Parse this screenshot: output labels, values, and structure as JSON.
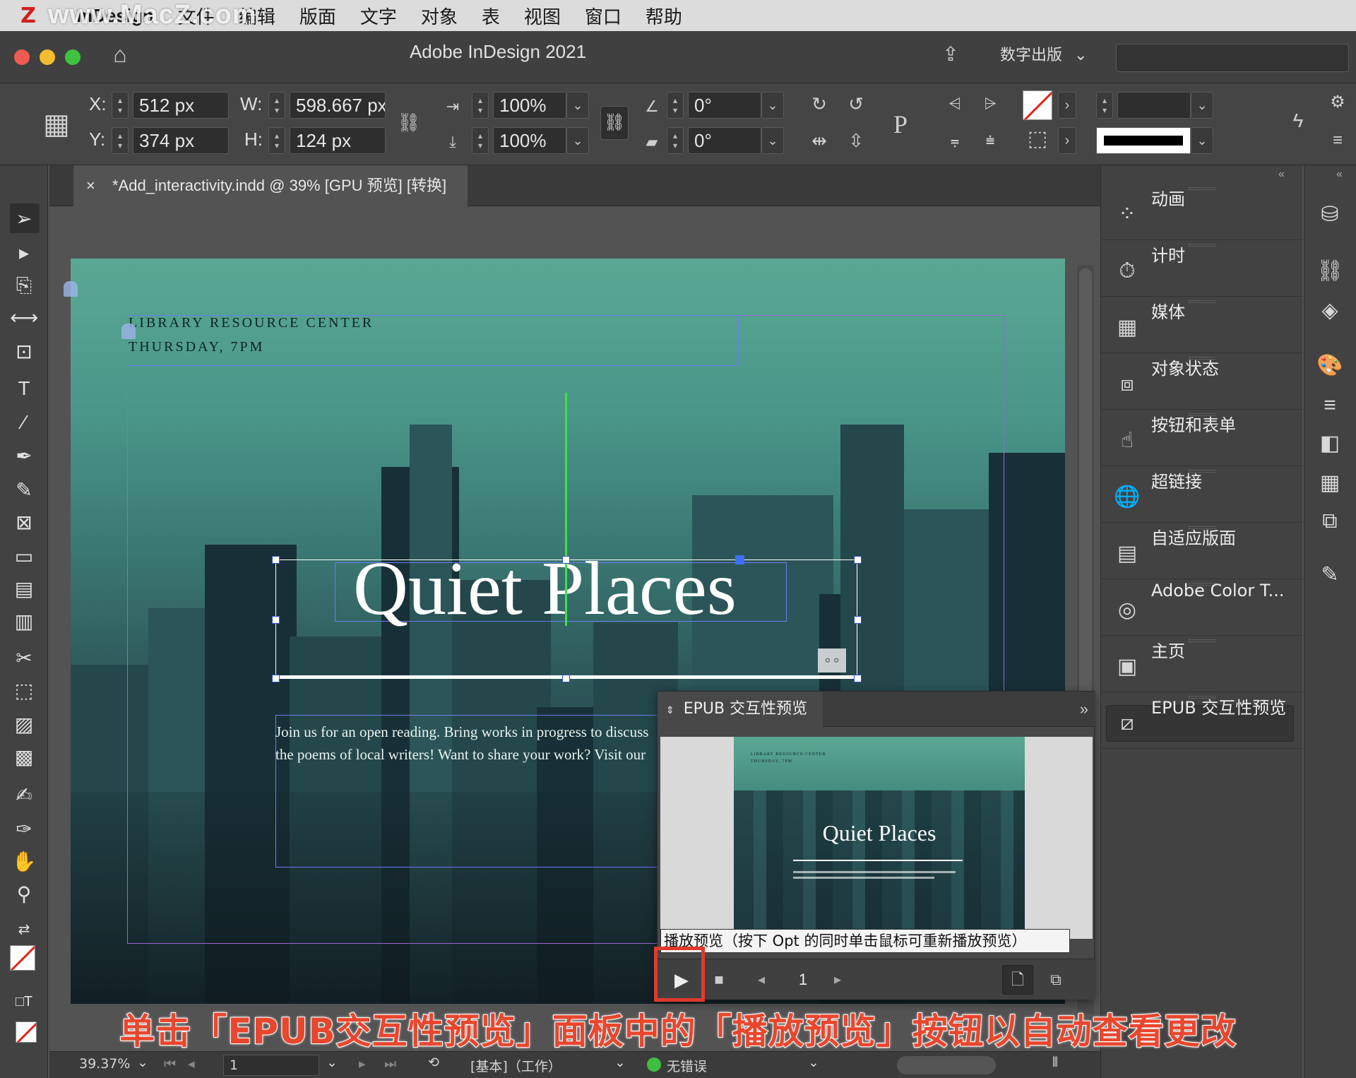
{
  "menubar": {
    "watermark": "www.MacZ.com",
    "app_name": "InDesign",
    "items": [
      "文件",
      "编辑",
      "版面",
      "文字",
      "对象",
      "表",
      "视图",
      "窗口",
      "帮助"
    ]
  },
  "titlebar": {
    "title": "Adobe InDesign 2021",
    "workspace": "数字出版"
  },
  "control": {
    "x_label": "X:",
    "x_value": "512 px",
    "y_label": "Y:",
    "y_value": "374 px",
    "w_label": "W:",
    "w_value": "598.667 px",
    "h_label": "H:",
    "h_value": "124 px",
    "scale_x": "100%",
    "scale_y": "100%",
    "rotate": "0°",
    "shear": "0°"
  },
  "document": {
    "tab_title": "*Add_interactivity.indd @ 39% [GPU 预览] [转换]",
    "header_line1": "LIBRARY RESOURCE CENTER",
    "header_line2": "THURSDAY, 7PM",
    "headline": "Quiet Places",
    "body_line1": "Join us for an open reading. Bring works in progress to discuss",
    "body_line2": "the poems of local writers! Want to share your work? Visit our"
  },
  "right_panels": [
    {
      "label": "动画",
      "icon": "animation-icon"
    },
    {
      "label": "计时",
      "icon": "timing-icon"
    },
    {
      "label": "媒体",
      "icon": "media-icon"
    },
    {
      "label": "对象状态",
      "icon": "object-states-icon"
    },
    {
      "label": "按钮和表单",
      "icon": "buttons-forms-icon"
    },
    {
      "label": "超链接",
      "icon": "hyperlinks-icon"
    },
    {
      "label": "自适应版面",
      "icon": "liquid-layout-icon"
    },
    {
      "label": "Adobe Color T...",
      "icon": "adobe-color-icon"
    },
    {
      "label": "主页",
      "icon": "pages-icon"
    },
    {
      "label": "EPUB 交互性预览",
      "icon": "epub-preview-icon"
    }
  ],
  "epub_panel": {
    "title": "EPUB 交互性预览",
    "mini_header1": "LIBRARY RESOURCE CENTER",
    "mini_header2": "THURSDAY, 7PM",
    "mini_headline": "Quiet Places",
    "page_number": "1",
    "tooltip": "播放预览（按下 Opt 的同时单击鼠标可重新播放预览）"
  },
  "statusbar": {
    "zoom": "39.37%",
    "page": "1",
    "profile": "[基本]（工作）",
    "preflight": "无错误"
  },
  "caption": "单击「EPUB交互性预览」面板中的「播放预览」按钮以自动查看更改",
  "colors": {
    "accent_red": "#e03a2c",
    "page_teal": "#4a978a",
    "preflight_green": "#3fbf3f"
  }
}
